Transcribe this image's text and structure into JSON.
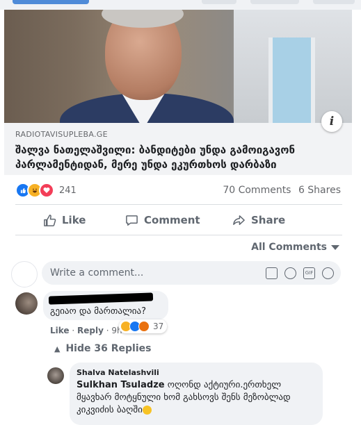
{
  "post": {
    "source": "RADIOTAVISUPLEBA.GE",
    "headline": "შალვა ნათელაშვილი: ბანდიტები უნდა გამოიგავონ პარლამენტიდან, მერე უნდა ეკურთხოს დარბაზი",
    "info_icon": "i"
  },
  "reactions": {
    "icons": [
      "like-icon",
      "haha-icon",
      "love-icon"
    ],
    "count": "241"
  },
  "stats": {
    "comments": "70 Comments",
    "shares": "6 Shares"
  },
  "actions": {
    "like": "Like",
    "comment": "Comment",
    "share": "Share"
  },
  "comments_filter": "All Comments",
  "write_comment": {
    "placeholder": "Write a comment...",
    "icons": [
      "camera-icon",
      "emoji-icon",
      "gif-icon",
      "sticker-icon"
    ]
  },
  "comment1": {
    "text": "გეიაო და მართალია?",
    "like_label": "Like",
    "reply_label": "Reply",
    "time": "9h",
    "reaction_count": "37"
  },
  "hide_replies": "Hide 36 Replies",
  "reply1": {
    "author": "Shalva Natelashvili",
    "mention": "Sulkhan Tsuladze",
    "text": "ოღონდ აქტიური.ერთხელ მყავხარ მოტყნული ხომ გახსოვს შენს მეზობლად კიკვიძის ბაღში"
  },
  "colors": {
    "like_blue": "#1877f2",
    "haha_yellow": "#f7b125",
    "love_red": "#f33e58",
    "text_gray": "#65676b"
  }
}
